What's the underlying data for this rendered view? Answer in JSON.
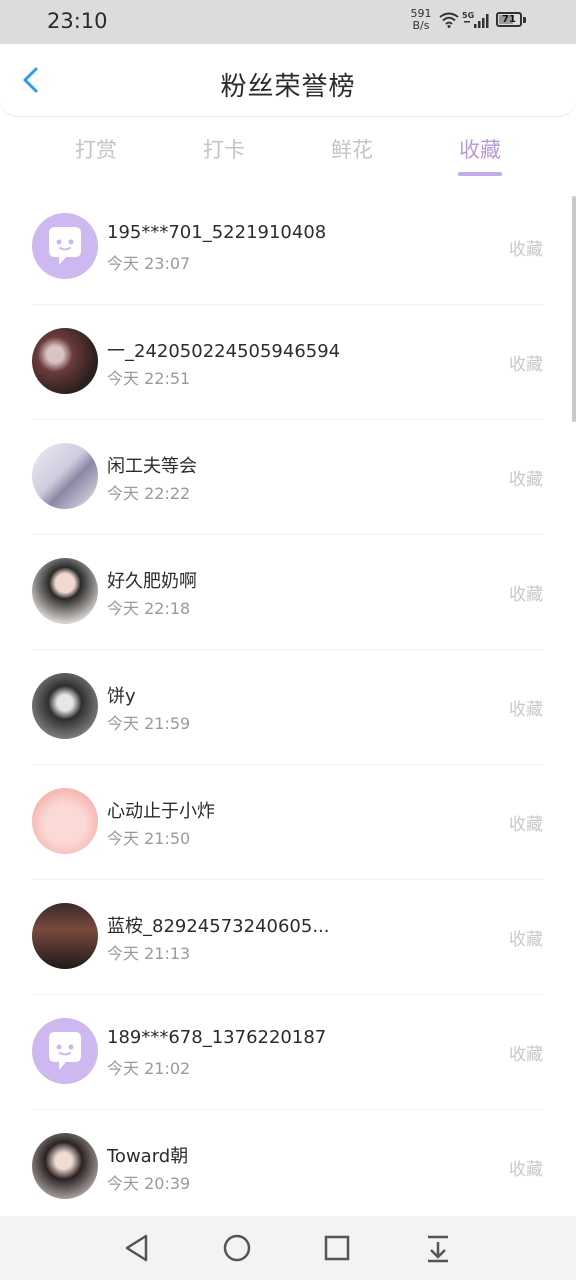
{
  "status_bar": {
    "time": "23:10",
    "net_speed_value": "591",
    "net_speed_unit": "B/s",
    "network": "5G",
    "battery": "71",
    "battery_level": 0.71
  },
  "header": {
    "title": "粉丝荣誉榜",
    "back_icon": "chevron-left-icon"
  },
  "tabs": [
    {
      "label": "打赏",
      "active": false
    },
    {
      "label": "打卡",
      "active": false
    },
    {
      "label": "鲜花",
      "active": false
    },
    {
      "label": "收藏",
      "active": true
    }
  ],
  "fans": [
    {
      "name": "195***701_5221910408",
      "time": "今天 23:07",
      "action": "收藏",
      "avatar": "default-chat-avatar"
    },
    {
      "name": "一_242050224505946594",
      "time": "今天 22:51",
      "action": "收藏",
      "avatar": "photo-avatar"
    },
    {
      "name": "闲工夫等会",
      "time": "今天 22:22",
      "action": "收藏",
      "avatar": "photo-avatar"
    },
    {
      "name": "好久肥奶啊",
      "time": "今天 22:18",
      "action": "收藏",
      "avatar": "photo-avatar"
    },
    {
      "name": "饼y",
      "time": "今天 21:59",
      "action": "收藏",
      "avatar": "photo-avatar"
    },
    {
      "name": "心动止于小炸",
      "time": "今天 21:50",
      "action": "收藏",
      "avatar": "cartoon-avatar"
    },
    {
      "name": "蓝桉_82924573240605...",
      "time": "今天 21:13",
      "action": "收藏",
      "avatar": "photo-avatar"
    },
    {
      "name": "189***678_1376220187",
      "time": "今天 21:02",
      "action": "收藏",
      "avatar": "default-chat-avatar"
    },
    {
      "name": "Toward朝",
      "time": "今天 20:39",
      "action": "收藏",
      "avatar": "photo-avatar"
    }
  ],
  "nav": {
    "back_icon": "triangle-back-icon",
    "home_icon": "circle-home-icon",
    "recent_icon": "square-recent-icon",
    "menu_icon": "download-menu-icon"
  },
  "colors": {
    "accent": "#b79bde",
    "avatar_purple": "#cdb8f0"
  }
}
